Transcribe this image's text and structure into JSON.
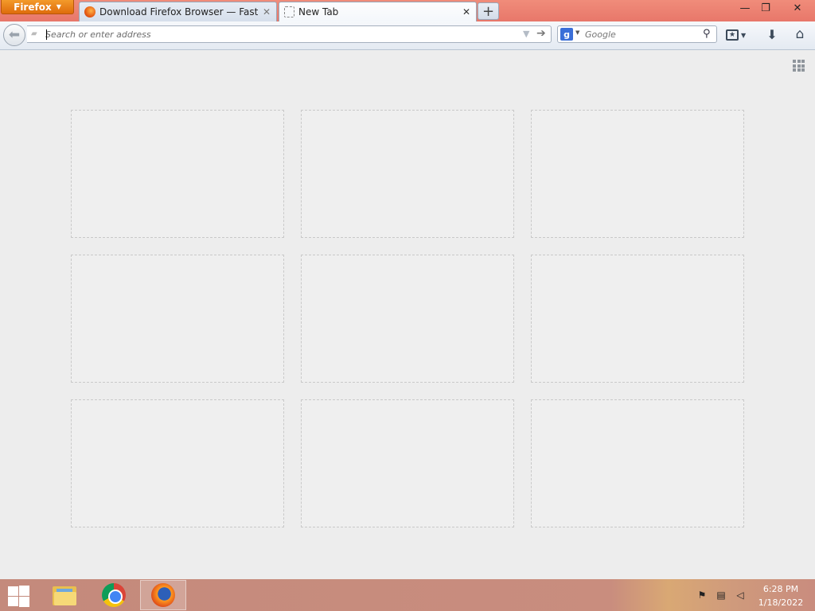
{
  "window": {
    "menu_button": "Firefox",
    "controls": {
      "minimize": "—",
      "maximize": "❐",
      "close": "✕"
    }
  },
  "tabs": [
    {
      "label": "Download Firefox Browser — Fast, Private & Free — from Mozilla",
      "favicon": "firefox-icon",
      "close": "✕",
      "active": false
    },
    {
      "label": "New Tab",
      "favicon": "blank-page-icon",
      "close": "✕",
      "active": true
    }
  ],
  "new_tab_label": "+",
  "navbar": {
    "back_icon": "arrow-left-icon",
    "url": {
      "value": "",
      "placeholder": "Search or enter address"
    },
    "search": {
      "engine": "Google",
      "engine_glyph": "g",
      "value": "",
      "placeholder": "Google"
    }
  },
  "newtab_page": {
    "tile_count": 9,
    "tiles": [
      {},
      {},
      {},
      {},
      {},
      {},
      {},
      {},
      {}
    ]
  },
  "taskbar": {
    "apps": [
      {
        "name": "File Explorer",
        "icon": "folder-icon",
        "active": false
      },
      {
        "name": "Google Chrome",
        "icon": "chrome-icon",
        "active": false
      },
      {
        "name": "Firefox",
        "icon": "firefox-icon",
        "active": true
      }
    ],
    "clock": {
      "time": "6:28 PM",
      "date": "1/18/2022"
    }
  },
  "colors": {
    "firefox_menu": "#e9770f",
    "titlebar": "#e9796b",
    "taskbar": "#c78c7d"
  }
}
